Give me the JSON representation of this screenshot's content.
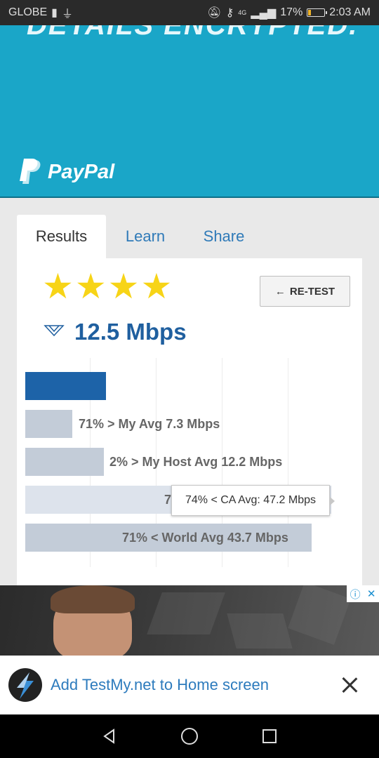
{
  "status_bar": {
    "carrier": "GLOBE",
    "battery": "17%",
    "time": "2:03 AM",
    "network": "4G"
  },
  "top_ad": {
    "headline": "DETAILS ENCRYPTED.",
    "brand": "PayPal",
    "background_color": "#1aa6c8"
  },
  "tabs": [
    {
      "label": "Results",
      "active": true
    },
    {
      "label": "Learn",
      "active": false
    },
    {
      "label": "Share",
      "active": false
    }
  ],
  "results": {
    "rating_stars": 4,
    "retest_label": "RE-TEST",
    "speed": "12.5 Mbps"
  },
  "comparison": {
    "bars": [
      {
        "name": "this-test",
        "value_mbps": 12.5,
        "label": ""
      },
      {
        "name": "my-avg",
        "value_mbps": 7.3,
        "label": "71% > My Avg 7.3 Mbps"
      },
      {
        "name": "my-host-avg",
        "value_mbps": 12.2,
        "label": "2% > My Host Avg 12.2 Mbps"
      },
      {
        "name": "ca-avg",
        "value_mbps": 47.2,
        "label": "74% < CA Avg: 47.2 Mbps"
      },
      {
        "name": "world-avg",
        "value_mbps": 43.7,
        "label": "71% < World Avg 43.7 Mbps"
      }
    ],
    "tooltip": "74% < CA Avg: 47.2 Mbps",
    "partial_label": "7"
  },
  "install_banner": {
    "text": "Add TestMy.net to Home screen"
  },
  "colors": {
    "accent_blue": "#1d63a8",
    "link_blue": "#2f7ab8",
    "star_yellow": "#f7d417"
  }
}
